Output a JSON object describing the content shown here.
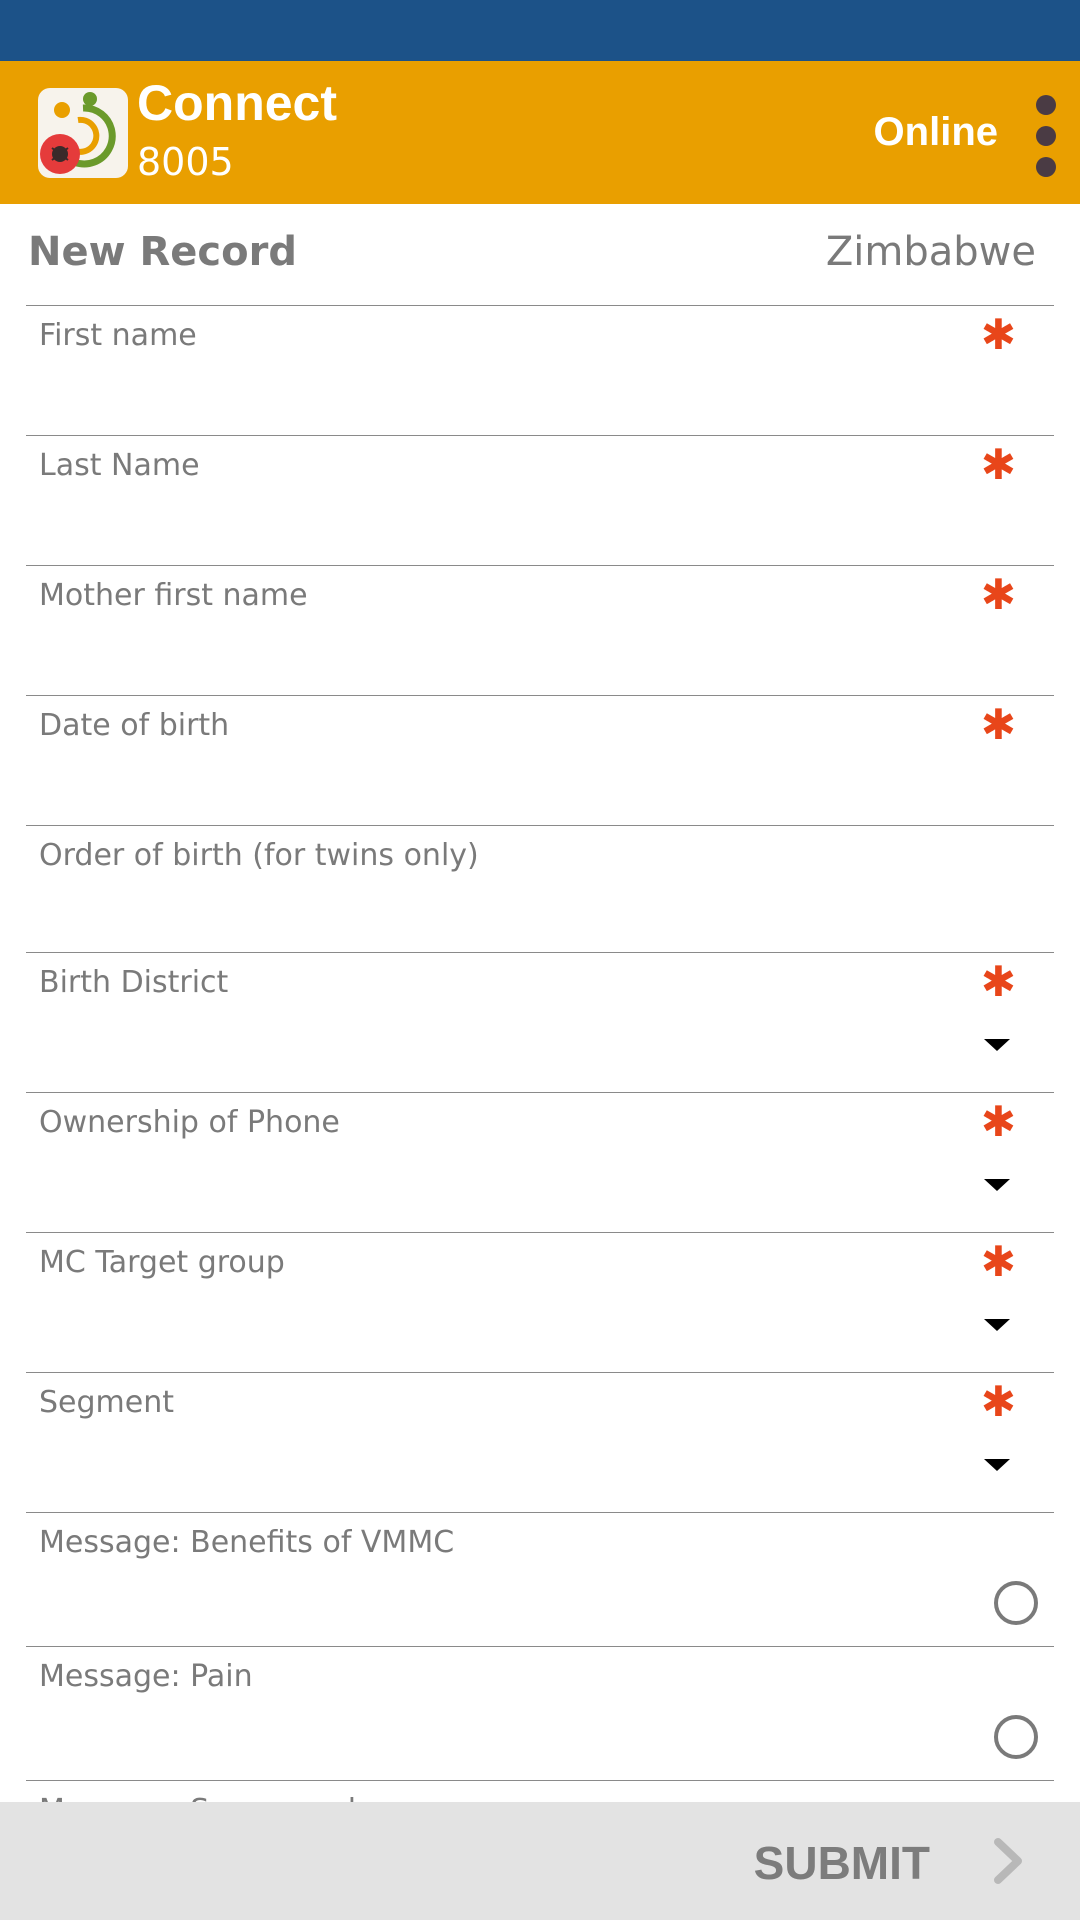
{
  "app_bar": {
    "title": "Connect",
    "subtitle": "8005",
    "status": "Online",
    "logo_icon": "connect-logo-icon",
    "menu_icon": "more-vert-icon",
    "color": "#e99f00"
  },
  "status_bar": {
    "color": "#1c5288"
  },
  "header": {
    "title": "New Record",
    "country": "Zimbabwe"
  },
  "fields": [
    {
      "label": "First name",
      "type": "text",
      "required": true,
      "value": ""
    },
    {
      "label": "Last Name",
      "type": "text",
      "required": true,
      "value": ""
    },
    {
      "label": "Mother first name",
      "type": "text",
      "required": true,
      "value": ""
    },
    {
      "label": "Date of birth",
      "type": "text",
      "required": true,
      "value": ""
    },
    {
      "label": "Order of birth (for twins only)",
      "type": "text",
      "required": false,
      "value": ""
    },
    {
      "label": "Birth District",
      "type": "select",
      "required": true,
      "value": ""
    },
    {
      "label": "Ownership of Phone",
      "type": "select",
      "required": true,
      "value": ""
    },
    {
      "label": "MC Target group",
      "type": "select",
      "required": true,
      "value": ""
    },
    {
      "label": "Segment",
      "type": "select",
      "required": true,
      "value": ""
    },
    {
      "label": "Message: Benefits of VMMC",
      "type": "radio",
      "required": false,
      "selected": false
    },
    {
      "label": "Message: Pain",
      "type": "radio",
      "required": false,
      "selected": false
    },
    {
      "label": "Message: Sex appeal",
      "type": "radio",
      "required": false,
      "selected": false
    }
  ],
  "required_marker": "✱",
  "required_color": "#e8461a",
  "footer": {
    "submit_label": "SUBMIT",
    "submit_icon": "chevron-right-icon"
  }
}
